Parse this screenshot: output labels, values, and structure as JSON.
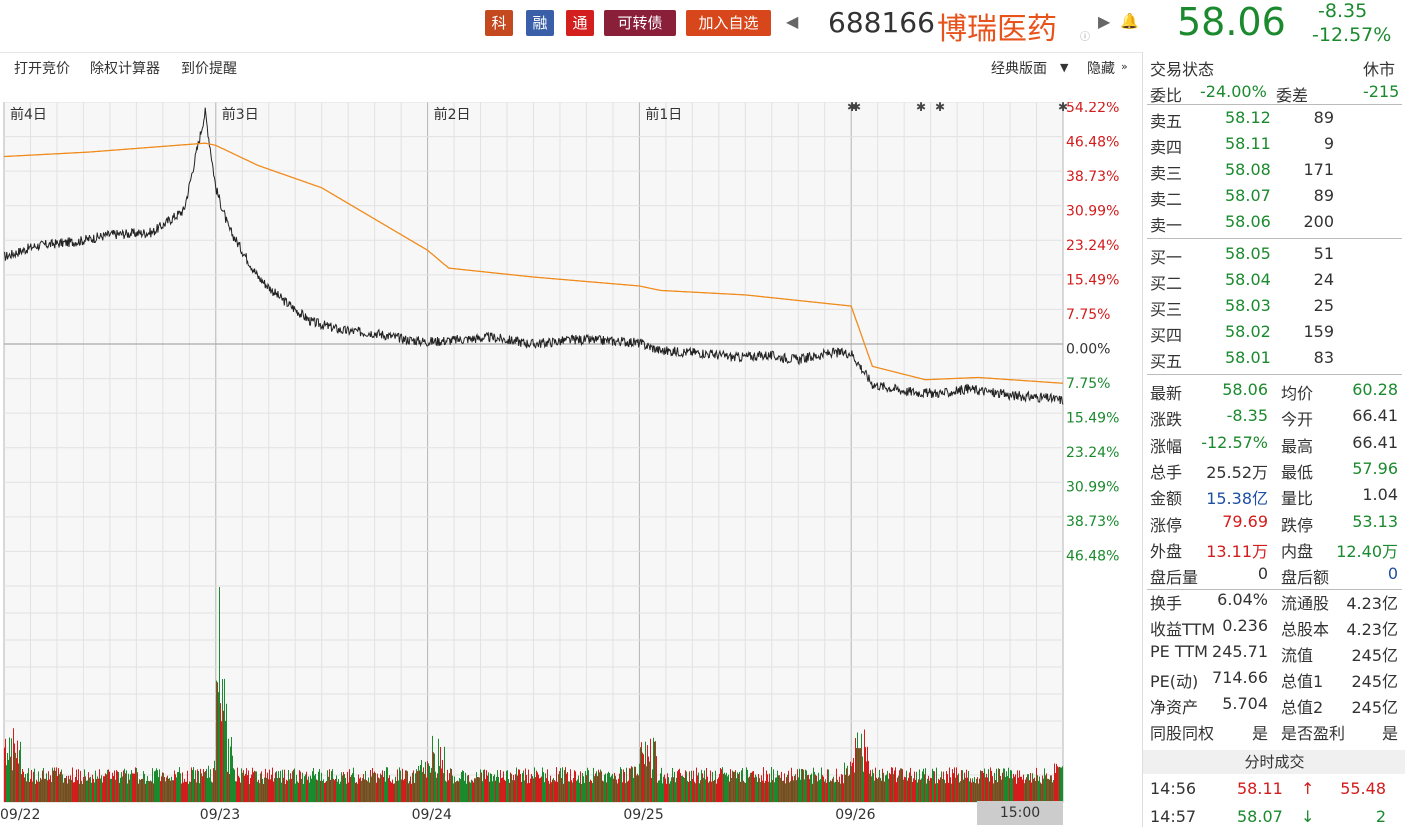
{
  "header": {
    "tags": [
      {
        "label": "科",
        "color": "#c5491f"
      },
      {
        "label": "融",
        "color": "#3a5fa8"
      },
      {
        "label": "通",
        "color": "#d41f1f"
      },
      {
        "label": "可转债",
        "color": "#8a1f3a"
      },
      {
        "label": "加入自选",
        "color": "#d8471c"
      }
    ],
    "code": "688166",
    "name": "博瑞医药",
    "price": "58.06",
    "change": "-8.35",
    "change_pct": "-12.57%"
  },
  "toolbar": {
    "left_items": [
      "打开竞价",
      "除权计算器",
      "到价提醒"
    ],
    "layout_label": "经典版面",
    "hide_label": "隐藏"
  },
  "chart_data": {
    "type": "line",
    "day_labels": [
      "前4日",
      "前3日",
      "前2日",
      "前1日"
    ],
    "date_labels": [
      "09/22",
      "09/23",
      "09/24",
      "09/25",
      "09/26"
    ],
    "time_label": "15:00",
    "right_axis": [
      "54.22%",
      "46.48%",
      "38.73%",
      "30.99%",
      "23.24%",
      "15.49%",
      "7.75%",
      "0.00%",
      "7.75%",
      "15.49%",
      "23.24%",
      "30.99%",
      "38.73%",
      "46.48%"
    ],
    "pct_ylim": [
      -54.22,
      54.22
    ],
    "series": [
      {
        "label": "price",
        "color": "#222222",
        "points": [
          [
            0,
            19.5
          ],
          [
            0.15,
            22.0
          ],
          [
            0.35,
            23.0
          ],
          [
            0.5,
            24.5
          ],
          [
            0.7,
            25.0
          ],
          [
            0.85,
            30.0
          ],
          [
            0.95,
            52.0
          ],
          [
            1.0,
            35.0
          ],
          [
            1.06,
            26.0
          ],
          [
            1.2,
            15.0
          ],
          [
            1.3,
            10.5
          ],
          [
            1.45,
            5.0
          ],
          [
            1.6,
            3.0
          ],
          [
            1.75,
            2.5
          ],
          [
            1.9,
            1.0
          ],
          [
            2.0,
            0.5
          ],
          [
            2.1,
            0.8
          ],
          [
            2.3,
            1.5
          ],
          [
            2.5,
            0.0
          ],
          [
            2.7,
            1.0
          ],
          [
            2.95,
            0.5
          ],
          [
            3.0,
            0.2
          ],
          [
            3.1,
            -1.5
          ],
          [
            3.3,
            -2.0
          ],
          [
            3.45,
            -3.0
          ],
          [
            3.6,
            -2.5
          ],
          [
            3.75,
            -3.5
          ],
          [
            3.9,
            -2.0
          ],
          [
            4.0,
            -2.0
          ],
          [
            4.1,
            -9.0
          ],
          [
            4.25,
            -10.5
          ],
          [
            4.35,
            -11.0
          ],
          [
            4.45,
            -11.0
          ],
          [
            4.55,
            -10.0
          ],
          [
            4.75,
            -11.5
          ],
          [
            4.9,
            -12.0
          ],
          [
            5.0,
            -12.57
          ]
        ]
      },
      {
        "label": "avg",
        "color": "#f08c1e",
        "points": [
          [
            0,
            42.0
          ],
          [
            0.4,
            43.0
          ],
          [
            0.95,
            45.0
          ],
          [
            1.0,
            44.5
          ],
          [
            1.2,
            40.0
          ],
          [
            1.5,
            35.0
          ],
          [
            2.0,
            21.0
          ],
          [
            2.1,
            17.0
          ],
          [
            2.5,
            15.0
          ],
          [
            3.0,
            13.0
          ],
          [
            3.1,
            12.0
          ],
          [
            3.5,
            11.0
          ],
          [
            4.0,
            8.5
          ],
          [
            4.1,
            -5.0
          ],
          [
            4.35,
            -8.0
          ],
          [
            4.6,
            -7.5
          ],
          [
            5.0,
            -8.8
          ]
        ]
      }
    ]
  },
  "quote": {
    "status_label": "交易状态",
    "status_value": "休市",
    "weibi_label": "委比",
    "weibi_value": "-24.00%",
    "weicha_label": "委差",
    "weicha_value": "-215",
    "asks": [
      {
        "label": "卖五",
        "price": "58.12",
        "vol": "89"
      },
      {
        "label": "卖四",
        "price": "58.11",
        "vol": "9"
      },
      {
        "label": "卖三",
        "price": "58.08",
        "vol": "171"
      },
      {
        "label": "卖二",
        "price": "58.07",
        "vol": "89"
      },
      {
        "label": "卖一",
        "price": "58.06",
        "vol": "200"
      }
    ],
    "bids": [
      {
        "label": "买一",
        "price": "58.05",
        "vol": "51"
      },
      {
        "label": "买二",
        "price": "58.04",
        "vol": "24"
      },
      {
        "label": "买三",
        "price": "58.03",
        "vol": "25"
      },
      {
        "label": "买四",
        "price": "58.02",
        "vol": "159"
      },
      {
        "label": "买五",
        "price": "58.01",
        "vol": "83"
      }
    ],
    "stats": [
      {
        "l1": "最新",
        "v1": "58.06",
        "c1": "g",
        "l2": "均价",
        "v2": "60.28",
        "c2": "g"
      },
      {
        "l1": "涨跌",
        "v1": "-8.35",
        "c1": "g",
        "l2": "今开",
        "v2": "66.41",
        "c2": "k"
      },
      {
        "l1": "涨幅",
        "v1": "-12.57%",
        "c1": "g",
        "l2": "最高",
        "v2": "66.41",
        "c2": "k"
      },
      {
        "l1": "总手",
        "v1": "25.52万",
        "c1": "k",
        "l2": "最低",
        "v2": "57.96",
        "c2": "g"
      },
      {
        "l1": "金额",
        "v1": "15.38亿",
        "c1": "bl",
        "l2": "量比",
        "v2": "1.04",
        "c2": "k"
      },
      {
        "l1": "涨停",
        "v1": "79.69",
        "c1": "rd",
        "l2": "跌停",
        "v2": "53.13",
        "c2": "g"
      },
      {
        "l1": "外盘",
        "v1": "13.11万",
        "c1": "rd",
        "l2": "内盘",
        "v2": "12.40万",
        "c2": "g"
      },
      {
        "l1": "盘后量",
        "v1": "0",
        "c1": "k",
        "l2": "盘后额",
        "v2": "0",
        "c2": "bl"
      }
    ],
    "fund": [
      {
        "l1": "换手",
        "v1": "6.04%",
        "l2": "流通股",
        "v2": "4.23亿"
      },
      {
        "l1": "收益TTM",
        "v1": "0.236",
        "l2": "总股本",
        "v2": "4.23亿"
      },
      {
        "l1": "PE TTM",
        "v1": "245.71",
        "l2": "流值",
        "v2": "245亿"
      },
      {
        "l1": "PE(动)",
        "v1": "714.66",
        "l2": "总值1",
        "v2": "245亿"
      },
      {
        "l1": "净资产",
        "v1": "5.704",
        "l2": "总值2",
        "v2": "245亿"
      },
      {
        "l1": "同股同权",
        "v1": "是",
        "l2": "是否盈利",
        "v2": "是"
      }
    ],
    "ticks_title": "分时成交",
    "ticks": [
      {
        "time": "14:56",
        "price": "58.11",
        "dir": "↑",
        "vol": "55.48",
        "color": "rd"
      },
      {
        "time": "14:57",
        "price": "58.07",
        "dir": "↓",
        "vol": "2",
        "color": "g"
      }
    ]
  }
}
